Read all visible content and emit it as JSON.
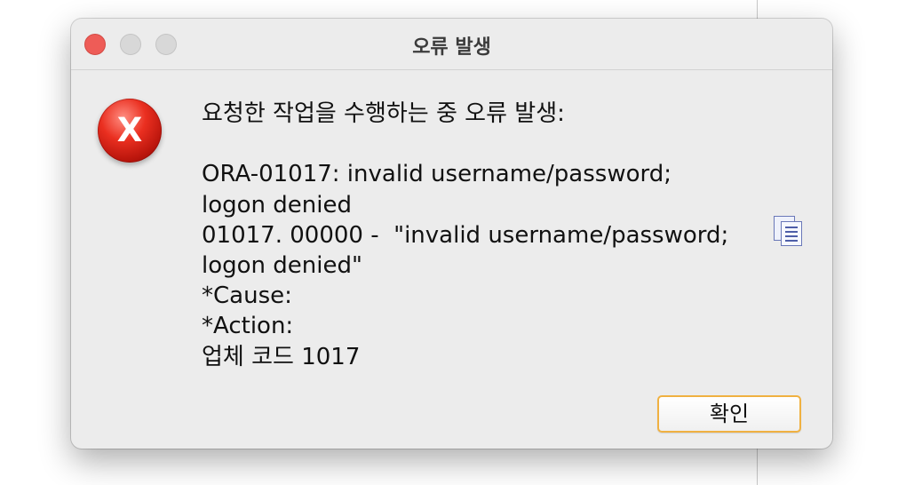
{
  "dialog": {
    "title": "오류 발생",
    "message_lines": [
      "요청한 작업을 수행하는 중 오류 발생:",
      "",
      "ORA-01017: invalid username/password;",
      "logon denied",
      "01017. 00000 -  \"invalid username/password;",
      "logon denied\"",
      "*Cause:",
      "*Action:",
      "업체 코드 1017"
    ],
    "error_icon_glyph": "X",
    "icon": "error-icon",
    "copy_icon": "copy-icon",
    "ok_label": "확인"
  },
  "colors": {
    "accent_button_border": "#f0b141",
    "close_button": "#ee5c57",
    "error_red": "#d0211a"
  }
}
